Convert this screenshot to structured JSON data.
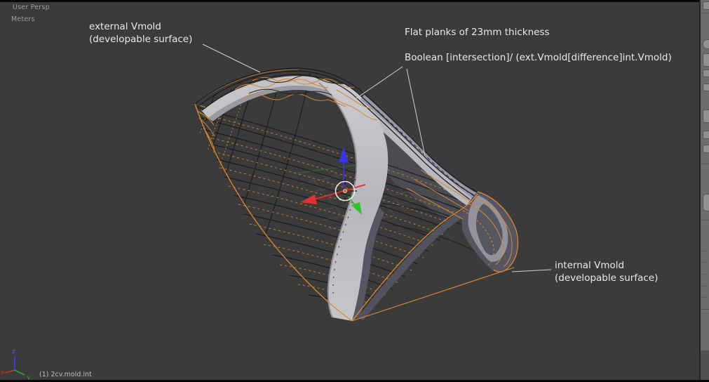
{
  "viewport": {
    "view_label": "User Persp",
    "unit_label": "Meters",
    "status_label": "(1) 2cv.mold.int"
  },
  "annotations": {
    "external_mold_line1": "external Vmold",
    "external_mold_line2": "(developable surface)",
    "flat_planks": "Flat planks of 23mm thickness",
    "boolean_op": "Boolean [intersection]/ (ext.Vmold[difference]int.Vmold)",
    "internal_mold_line1": "internal Vmold",
    "internal_mold_line2": "(developable surface)"
  },
  "axis_gizmo": {
    "x_label": "x",
    "y_label": "y",
    "z_label": "z"
  },
  "colors": {
    "viewport_background": "#3b3b3b",
    "selected_wire_orange": "#e0892c",
    "mesh_wire_black": "#1d1d1f",
    "plank_light_gray": "#c2c2c7",
    "boolean_band_blue_gray": "#9898a8",
    "crescent_fill": "#565662",
    "manipulator_x_red": "#e03030",
    "manipulator_y_green": "#2ec22e",
    "manipulator_z_blue": "#3535e8",
    "axis_x_red": "#cc3333",
    "axis_y_green": "#2ea22e",
    "axis_z_blue": "#4747ff",
    "annotation_text": "#e9e9e9",
    "leader_line": "#d0d0d0"
  }
}
